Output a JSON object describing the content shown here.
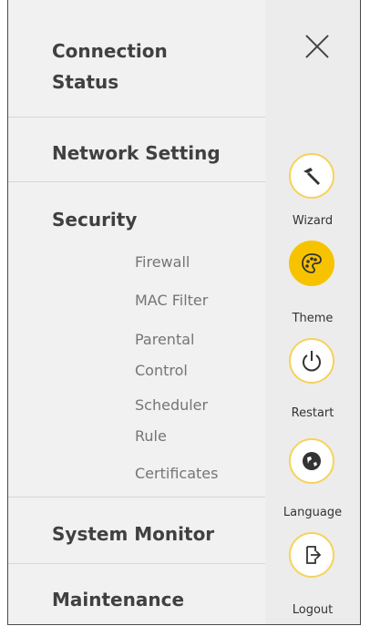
{
  "menu": {
    "connection_status": [
      "Connection",
      "Status"
    ],
    "network_setting": "Network Setting",
    "security": "Security",
    "security_items": [
      [
        "Firewall"
      ],
      [
        "MAC Filter"
      ],
      [
        "Parental",
        "Control"
      ],
      [
        "Scheduler",
        "Rule"
      ],
      [
        "Certificates"
      ]
    ],
    "system_monitor": "System Monitor",
    "maintenance": "Maintenance"
  },
  "rail": {
    "wizard": "Wizard",
    "theme": "Theme",
    "restart": "Restart",
    "language": "Language",
    "logout": "Logout"
  },
  "colors": {
    "accent": "#f7c300",
    "accent_border": "#f6d25a",
    "menu_bg": "#f1f1f1",
    "rail_bg": "#ececec"
  },
  "icons": [
    "close-icon",
    "wizard-icon",
    "theme-icon",
    "restart-icon",
    "language-icon",
    "logout-icon"
  ]
}
